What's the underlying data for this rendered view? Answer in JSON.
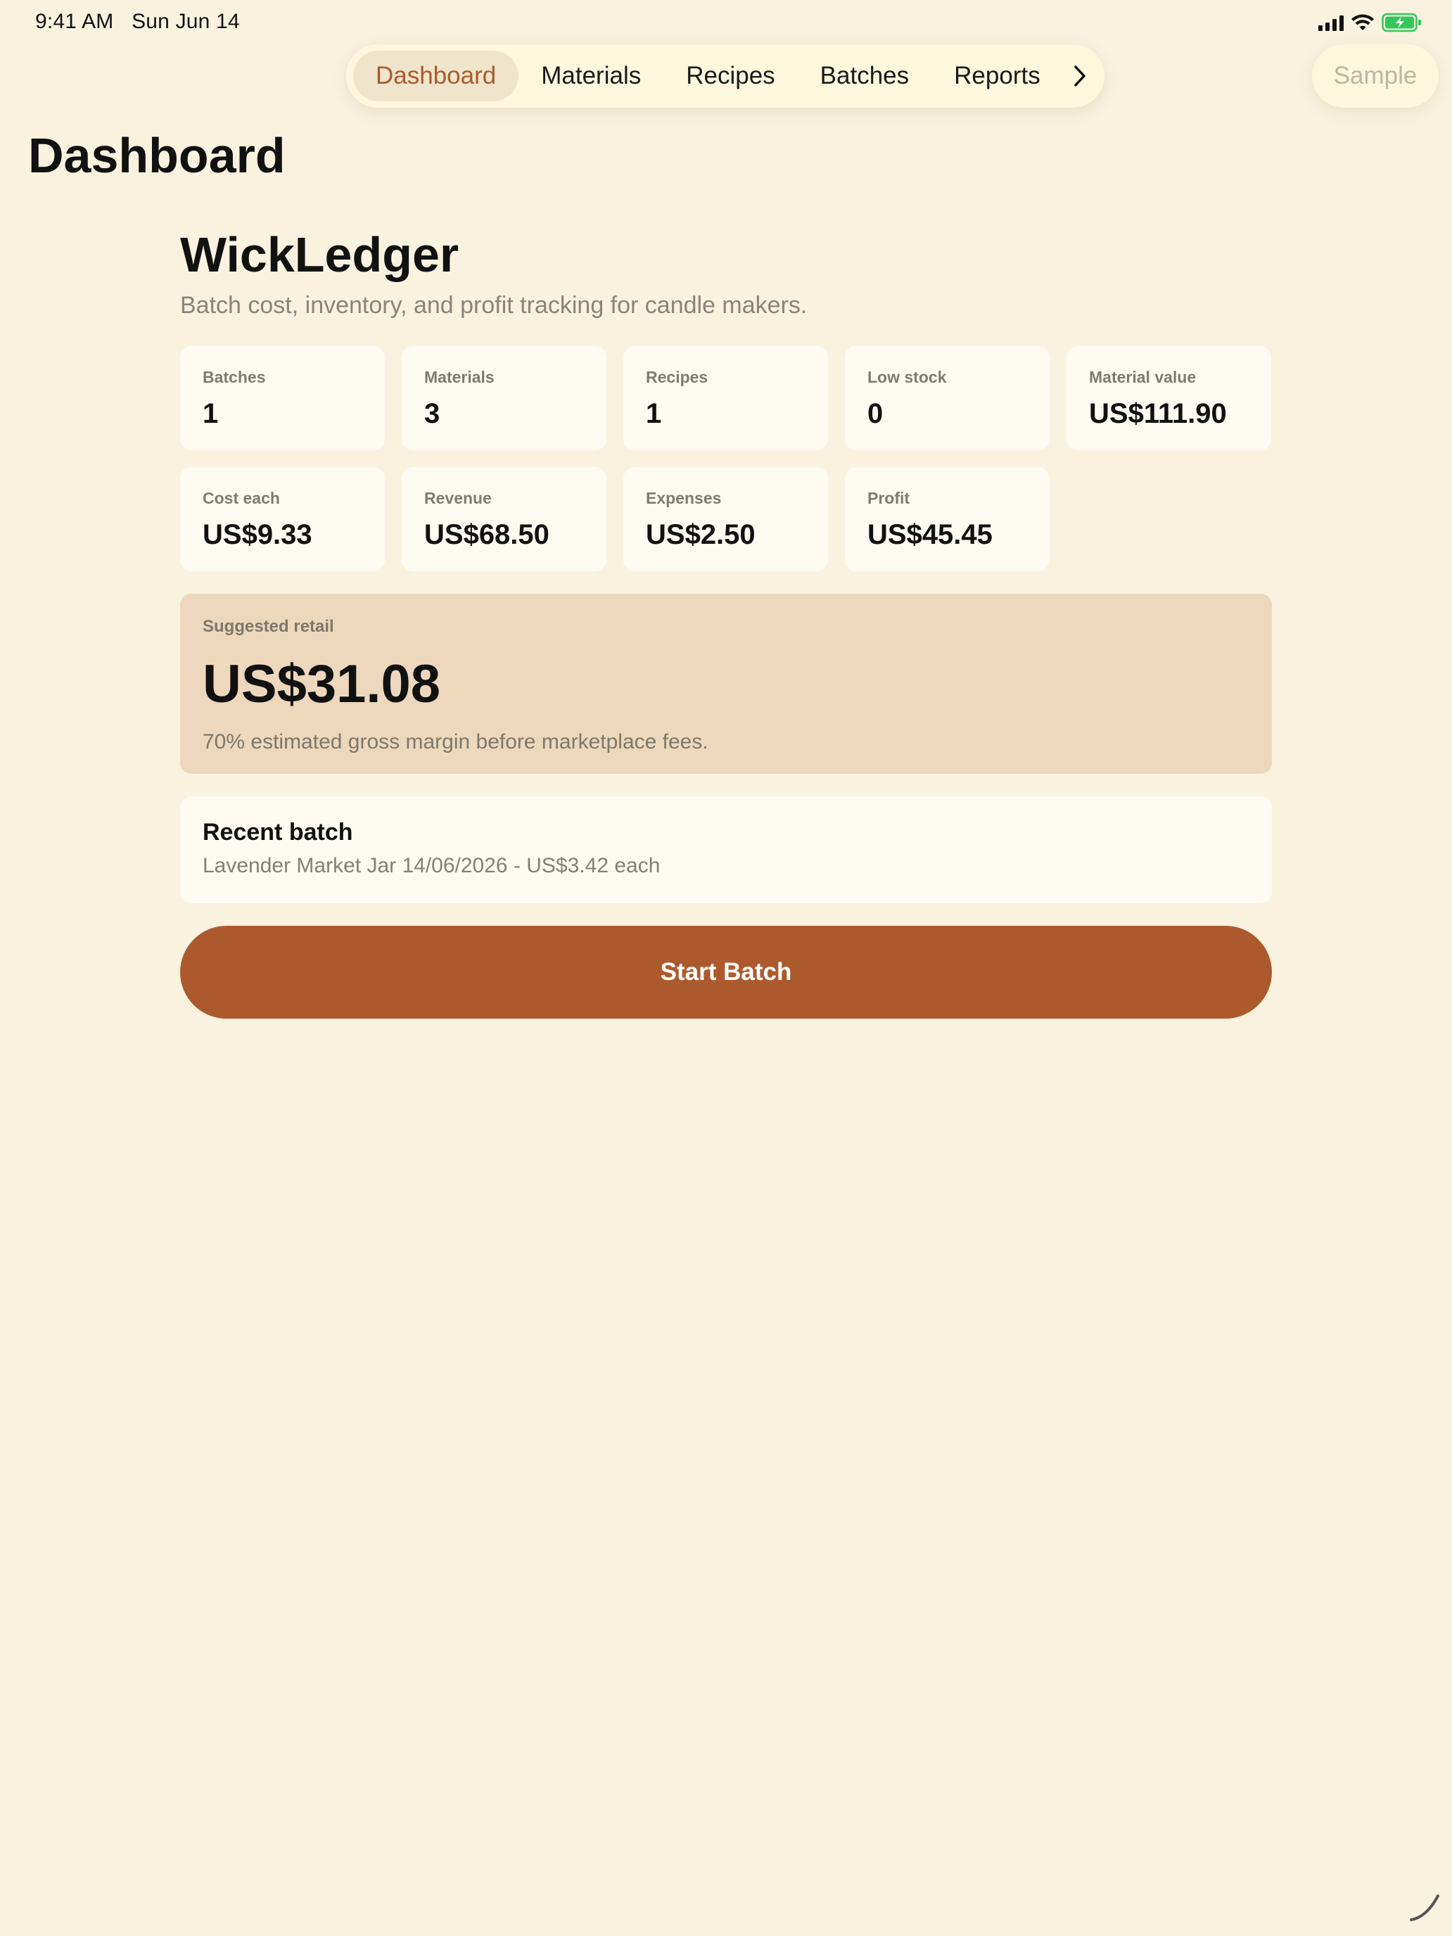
{
  "status_bar": {
    "time": "9:41 AM",
    "date": "Sun Jun 14",
    "icons": [
      "cellular-signal-icon",
      "wifi-icon",
      "battery-charging-icon"
    ],
    "battery_color": "#34C759"
  },
  "tabs": [
    {
      "label": "Dashboard",
      "active": true
    },
    {
      "label": "Materials",
      "active": false
    },
    {
      "label": "Recipes",
      "active": false
    },
    {
      "label": "Batches",
      "active": false
    },
    {
      "label": "Reports",
      "active": false
    }
  ],
  "tab_more_icon": "chevron-right-icon",
  "sample_button": {
    "label": "Sample",
    "disabled": true
  },
  "page_title": "Dashboard",
  "app": {
    "name": "WickLedger",
    "subtitle": "Batch cost, inventory, and profit tracking for candle makers."
  },
  "stats": [
    {
      "label": "Batches",
      "value": "1"
    },
    {
      "label": "Materials",
      "value": "3"
    },
    {
      "label": "Recipes",
      "value": "1"
    },
    {
      "label": "Low stock",
      "value": "0"
    },
    {
      "label": "Material value",
      "value": "US$111.90"
    },
    {
      "label": "Cost each",
      "value": "US$9.33"
    },
    {
      "label": "Revenue",
      "value": "US$68.50"
    },
    {
      "label": "Expenses",
      "value": "US$2.50"
    },
    {
      "label": "Profit",
      "value": "US$45.45"
    }
  ],
  "suggested_retail": {
    "label": "Suggested retail",
    "value": "US$31.08",
    "note": "70% estimated gross margin before marketplace fees."
  },
  "recent_batch": {
    "title": "Recent batch",
    "detail": "Lavender Market Jar 14/06/2026 - US$3.42 each"
  },
  "start_button": {
    "label": "Start Batch"
  },
  "colors": {
    "background": "#F8F2DF",
    "accent": "#AC5A2D",
    "card": "#FDFBF2",
    "retail_card": "#EDD8BD",
    "active_tab_bg": "#EEE5CC"
  }
}
